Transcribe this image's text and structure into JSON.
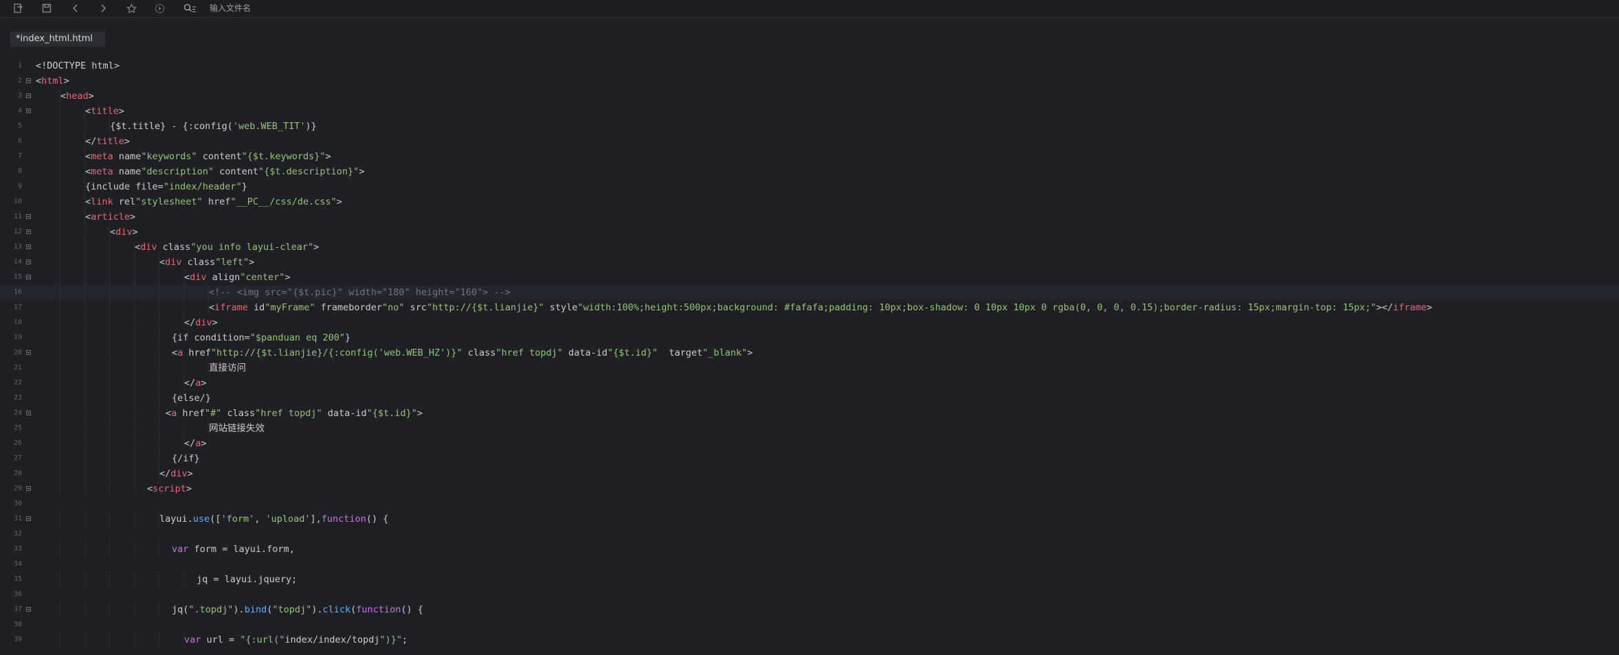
{
  "toolbar": {
    "icons": [
      "file-transfer-icon",
      "save-icon",
      "back-icon",
      "forward-icon",
      "star-icon",
      "play-icon",
      "search-file-icon"
    ],
    "search_placeholder": "输入文件名"
  },
  "tab": {
    "label": "*index_html.html"
  },
  "colors": {
    "background": "#1e2025",
    "tag": "#e06c75",
    "attr": "#d19a66",
    "string": "#98c379",
    "comment": "#6f7680",
    "keyword": "#c678dd",
    "function": "#61afef"
  },
  "editor": {
    "highlighted_line": 16,
    "lines": [
      {
        "n": "1",
        "indent": 0,
        "fold": false,
        "code": "<!DOCTYPE html>"
      },
      {
        "n": "2",
        "indent": 0,
        "fold": true,
        "code": "<html>"
      },
      {
        "n": "3",
        "indent": 1,
        "fold": true,
        "code": "<head>"
      },
      {
        "n": "4",
        "indent": 2,
        "fold": true,
        "code": "<title>"
      },
      {
        "n": "5",
        "indent": 3,
        "fold": false,
        "code": "{$t.title} - {:config('web.WEB_TIT')}"
      },
      {
        "n": "6",
        "indent": 2,
        "fold": false,
        "code": "</title>"
      },
      {
        "n": "7",
        "indent": 2,
        "fold": false,
        "code": "<meta name=\"keywords\" content=\"{$t.keywords}\">"
      },
      {
        "n": "8",
        "indent": 2,
        "fold": false,
        "code": "<meta name=\"description\" content=\"{$t.description}\">"
      },
      {
        "n": "9",
        "indent": 2,
        "fold": false,
        "code": "{include file=\"index/header\"}"
      },
      {
        "n": "10",
        "indent": 2,
        "fold": false,
        "code": "<link rel=\"stylesheet\" href=\"__PC__/css/de.css\">"
      },
      {
        "n": "11",
        "indent": 2,
        "fold": true,
        "code": "<article>"
      },
      {
        "n": "12",
        "indent": 3,
        "fold": true,
        "code": "<div>"
      },
      {
        "n": "13",
        "indent": 4,
        "fold": true,
        "code": "<div class=\"you info layui-clear\">"
      },
      {
        "n": "14",
        "indent": 5,
        "fold": true,
        "code": "<div class=\"left\">"
      },
      {
        "n": "15",
        "indent": 6,
        "fold": true,
        "code": "<div align=\"center\">"
      },
      {
        "n": "16",
        "indent": 7,
        "fold": false,
        "code": "<!-- <img src=\"{$t.pic}\" width=\"180\" height=\"160\"> -->"
      },
      {
        "n": "17",
        "indent": 7,
        "fold": false,
        "code": "<iframe id=\"myFrame\" frameborder=\"no\" src=\"http://{$t.lianjie}\" style=\"width:100%;height:500px;background: #fafafa;padding: 10px;box-shadow: 0 10px 10px 0 rgba(0, 0, 0, 0.15);border-radius: 15px;margin-top: 15px;\"></iframe>"
      },
      {
        "n": "18",
        "indent": 6,
        "fold": false,
        "code": "</div>"
      },
      {
        "n": "19",
        "indent": 5.5,
        "fold": false,
        "code": "{if condition=\"$panduan eq 200\"}"
      },
      {
        "n": "20",
        "indent": 5.5,
        "fold": true,
        "code": "<a href=\"http://{$t.lianjie}/{:config('web.WEB_HZ')}\" class=\"href topdj\" data-id=\"{$t.id}\"  target=\"_blank\">"
      },
      {
        "n": "21",
        "indent": 7,
        "fold": false,
        "code": "直接访问"
      },
      {
        "n": "22",
        "indent": 6,
        "fold": false,
        "code": "</a>"
      },
      {
        "n": "23",
        "indent": 5.5,
        "fold": false,
        "code": "{else/}"
      },
      {
        "n": "24",
        "indent": 5.25,
        "fold": true,
        "code": "<a href=\"#\" class=\"href topdj\" data-id=\"{$t.id}\">"
      },
      {
        "n": "25",
        "indent": 7,
        "fold": false,
        "code": "网站链接失效"
      },
      {
        "n": "26",
        "indent": 6,
        "fold": false,
        "code": "</a>"
      },
      {
        "n": "27",
        "indent": 5.5,
        "fold": false,
        "code": "{/if}"
      },
      {
        "n": "28",
        "indent": 5,
        "fold": false,
        "code": "</div>"
      },
      {
        "n": "29",
        "indent": 4.5,
        "fold": true,
        "code": "<script>"
      },
      {
        "n": "30",
        "indent": 0,
        "fold": false,
        "code": ""
      },
      {
        "n": "31",
        "indent": 5,
        "fold": true,
        "code": "layui.use(['form', 'upload'],function() {"
      },
      {
        "n": "32",
        "indent": 0,
        "fold": false,
        "code": ""
      },
      {
        "n": "33",
        "indent": 5.5,
        "fold": false,
        "code": "var form = layui.form,"
      },
      {
        "n": "34",
        "indent": 0,
        "fold": false,
        "code": ""
      },
      {
        "n": "35",
        "indent": 6.5,
        "fold": false,
        "code": "jq = layui.jquery;"
      },
      {
        "n": "36",
        "indent": 0,
        "fold": false,
        "code": ""
      },
      {
        "n": "37",
        "indent": 5.5,
        "fold": true,
        "code": "jq(\".topdj\").bind(\"topdj\").click(function() {"
      },
      {
        "n": "38",
        "indent": 0,
        "fold": false,
        "code": ""
      },
      {
        "n": "39",
        "indent": 6,
        "fold": false,
        "code": "var url = \"{:url(\"index/index/topdj\")}\";"
      }
    ]
  }
}
